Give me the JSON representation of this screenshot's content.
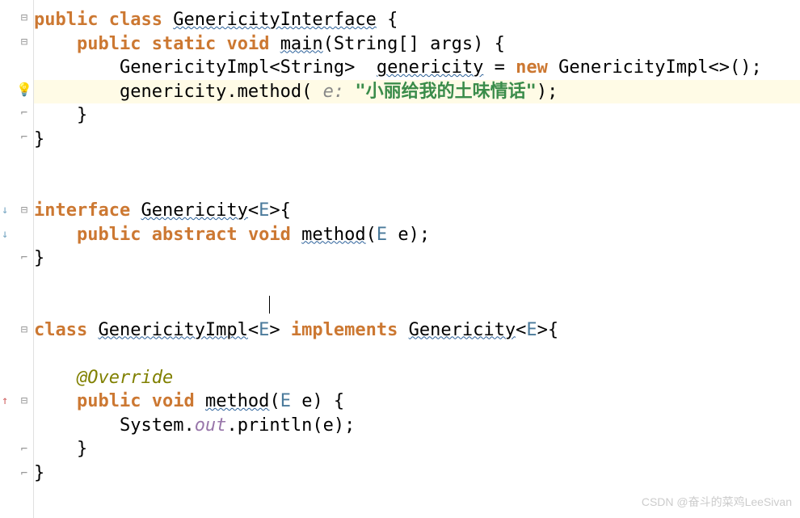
{
  "code": {
    "l1": {
      "kw_public": "public",
      "kw_class": "class",
      "classname": "GenericityInterface",
      "brace": " {"
    },
    "l2": {
      "pad": "    ",
      "kw_public": "public",
      "kw_static": "static",
      "kw_void": "void",
      "m_main": "main",
      "arg_type": "String[] ",
      "arg_name": "args",
      "brace": ") {"
    },
    "l3": {
      "pad": "        ",
      "type": "GenericityImpl",
      "lt": "<",
      "generic": "String",
      "gt": ">",
      "sp": "  ",
      "varname": "genericity",
      "eq": " = ",
      "kw_new": "new",
      "ctor": " GenericityImpl<>();"
    },
    "l4": {
      "pad": "        ",
      "obj": "genericity",
      "dot": ".",
      "method": "method",
      "open": "( ",
      "hint": "e:",
      "sp": " ",
      "str": "\"小丽给我的土味情话\"",
      "close": ");"
    },
    "l5": {
      "pad": "    ",
      "brace": "}"
    },
    "l6": {
      "brace": "}"
    },
    "l7": {
      "kw_interface": "interface",
      "ifname": "Genericity",
      "lt": "<",
      "tp": "E",
      "gt": ">{"
    },
    "l8": {
      "pad": "    ",
      "kw_public": "public",
      "kw_abstract": "abstract",
      "kw_void": "void",
      "method": "method",
      "open": "(",
      "tp": "E",
      "sp": " ",
      "argname": "e",
      "close": ");"
    },
    "l9": {
      "brace": "}"
    },
    "l10": {
      "kw_class": "class",
      "classname": "GenericityImpl",
      "lt1": "<",
      "tp1": "E",
      "gt1": ">",
      "kw_implements": "implements",
      "ifname": "Genericity",
      "lt2": "<",
      "tp2": "E",
      "gt2": ">{"
    },
    "l11": {
      "pad": "    ",
      "annotation": "@Override"
    },
    "l12": {
      "pad": "    ",
      "kw_public": "public",
      "kw_void": "void",
      "method": "method",
      "open": "(",
      "tp": "E",
      "sp": " ",
      "argname": "e",
      "close": ") {"
    },
    "l13": {
      "pad": "        ",
      "sysout": "System.",
      "out": "out",
      "dot": ".",
      "println": "println(e);"
    },
    "l14": {
      "pad": "    ",
      "brace": "}"
    },
    "l15": {
      "brace": "}"
    }
  },
  "watermark": "CSDN @奋斗的菜鸡LeeSivan"
}
